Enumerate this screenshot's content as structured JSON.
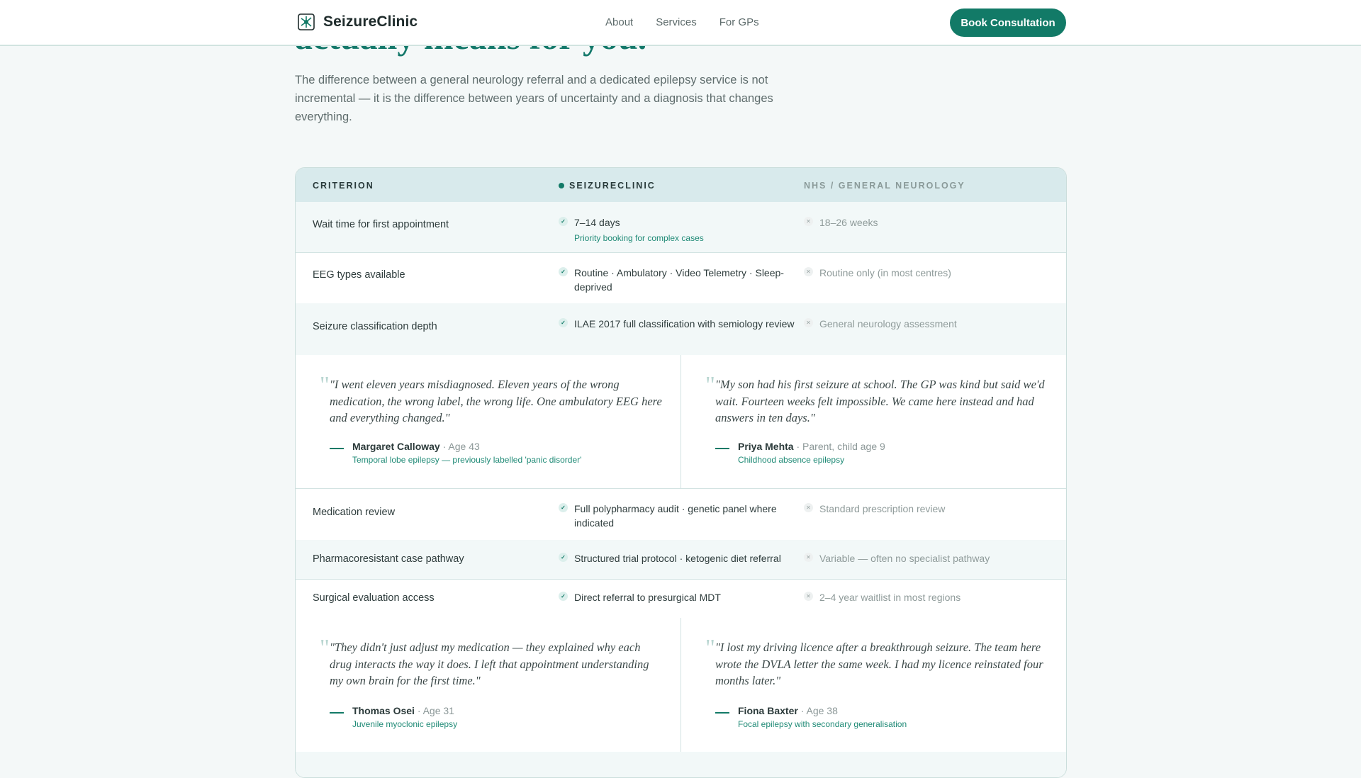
{
  "header": {
    "brand": "SeizureClinic",
    "nav": [
      "About",
      "Services",
      "For GPs"
    ],
    "cta": "Book Consultation"
  },
  "hero": {
    "title_fragment": "actually means for you.",
    "intro": "The difference between a general neurology referral and a dedicated epilepsy service is not incremental — it is the difference between years of uncertainty and a diagnosis that changes everything."
  },
  "table": {
    "headers": [
      "CRITERION",
      "SEIZURECLINIC",
      "NHS / GENERAL NEUROLOGY"
    ],
    "rows": [
      {
        "criterion": "Wait time for first appointment",
        "clinic": "7–14 days",
        "clinic_sub": "Priority booking for complex cases",
        "nhs": "18–26 weeks"
      },
      {
        "criterion": "EEG types available",
        "clinic": "Routine · Ambulatory · Video Telemetry · Sleep-deprived",
        "clinic_sub": "",
        "nhs": "Routine only (in most centres)"
      },
      {
        "criterion": "Seizure classification depth",
        "clinic": "ILAE 2017 full classification with semiology review",
        "clinic_sub": "",
        "nhs": "General neurology assessment"
      },
      {
        "criterion": "Medication review",
        "clinic": "Full polypharmacy audit · genetic panel where indicated",
        "clinic_sub": "",
        "nhs": "Standard prescription review"
      },
      {
        "criterion": "Pharmacoresistant case pathway",
        "clinic": "Structured trial protocol · ketogenic diet referral",
        "clinic_sub": "",
        "nhs": "Variable — often no specialist pathway"
      },
      {
        "criterion": "Surgical evaluation access",
        "clinic": "Direct referral to presurgical MDT",
        "clinic_sub": "",
        "nhs": "2–4 year waitlist in most regions"
      }
    ],
    "testimonials": [
      {
        "quote": "\"I went eleven years misdiagnosed. Eleven years of the wrong medication, the wrong label, the wrong life. One ambulatory EEG here and everything changed.\"",
        "name": "Margaret Calloway",
        "meta": "· Age 43",
        "condition": "Temporal lobe epilepsy — previously labelled 'panic disorder'"
      },
      {
        "quote": "\"My son had his first seizure at school. The GP was kind but said we'd wait. Fourteen weeks felt impossible. We came here instead and had answers in ten days.\"",
        "name": "Priya Mehta",
        "meta": "· Parent, child age 9",
        "condition": "Childhood absence epilepsy"
      },
      {
        "quote": "\"They didn't just adjust my medication — they explained why each drug interacts the way it does. I left that appointment understanding my own brain for the first time.\"",
        "name": "Thomas Osei",
        "meta": "· Age 31",
        "condition": "Juvenile myoclonic epilepsy"
      },
      {
        "quote": "\"I lost my driving licence after a breakthrough seizure. The team here wrote the DVLA letter the same week. I had my licence reinstated four months later.\"",
        "name": "Fiona Baxter",
        "meta": "· Age 38",
        "condition": "Focal epilepsy with secondary generalisation"
      }
    ]
  },
  "colors": {
    "accent": "#127a67",
    "header_bg": "#d8eaec"
  }
}
